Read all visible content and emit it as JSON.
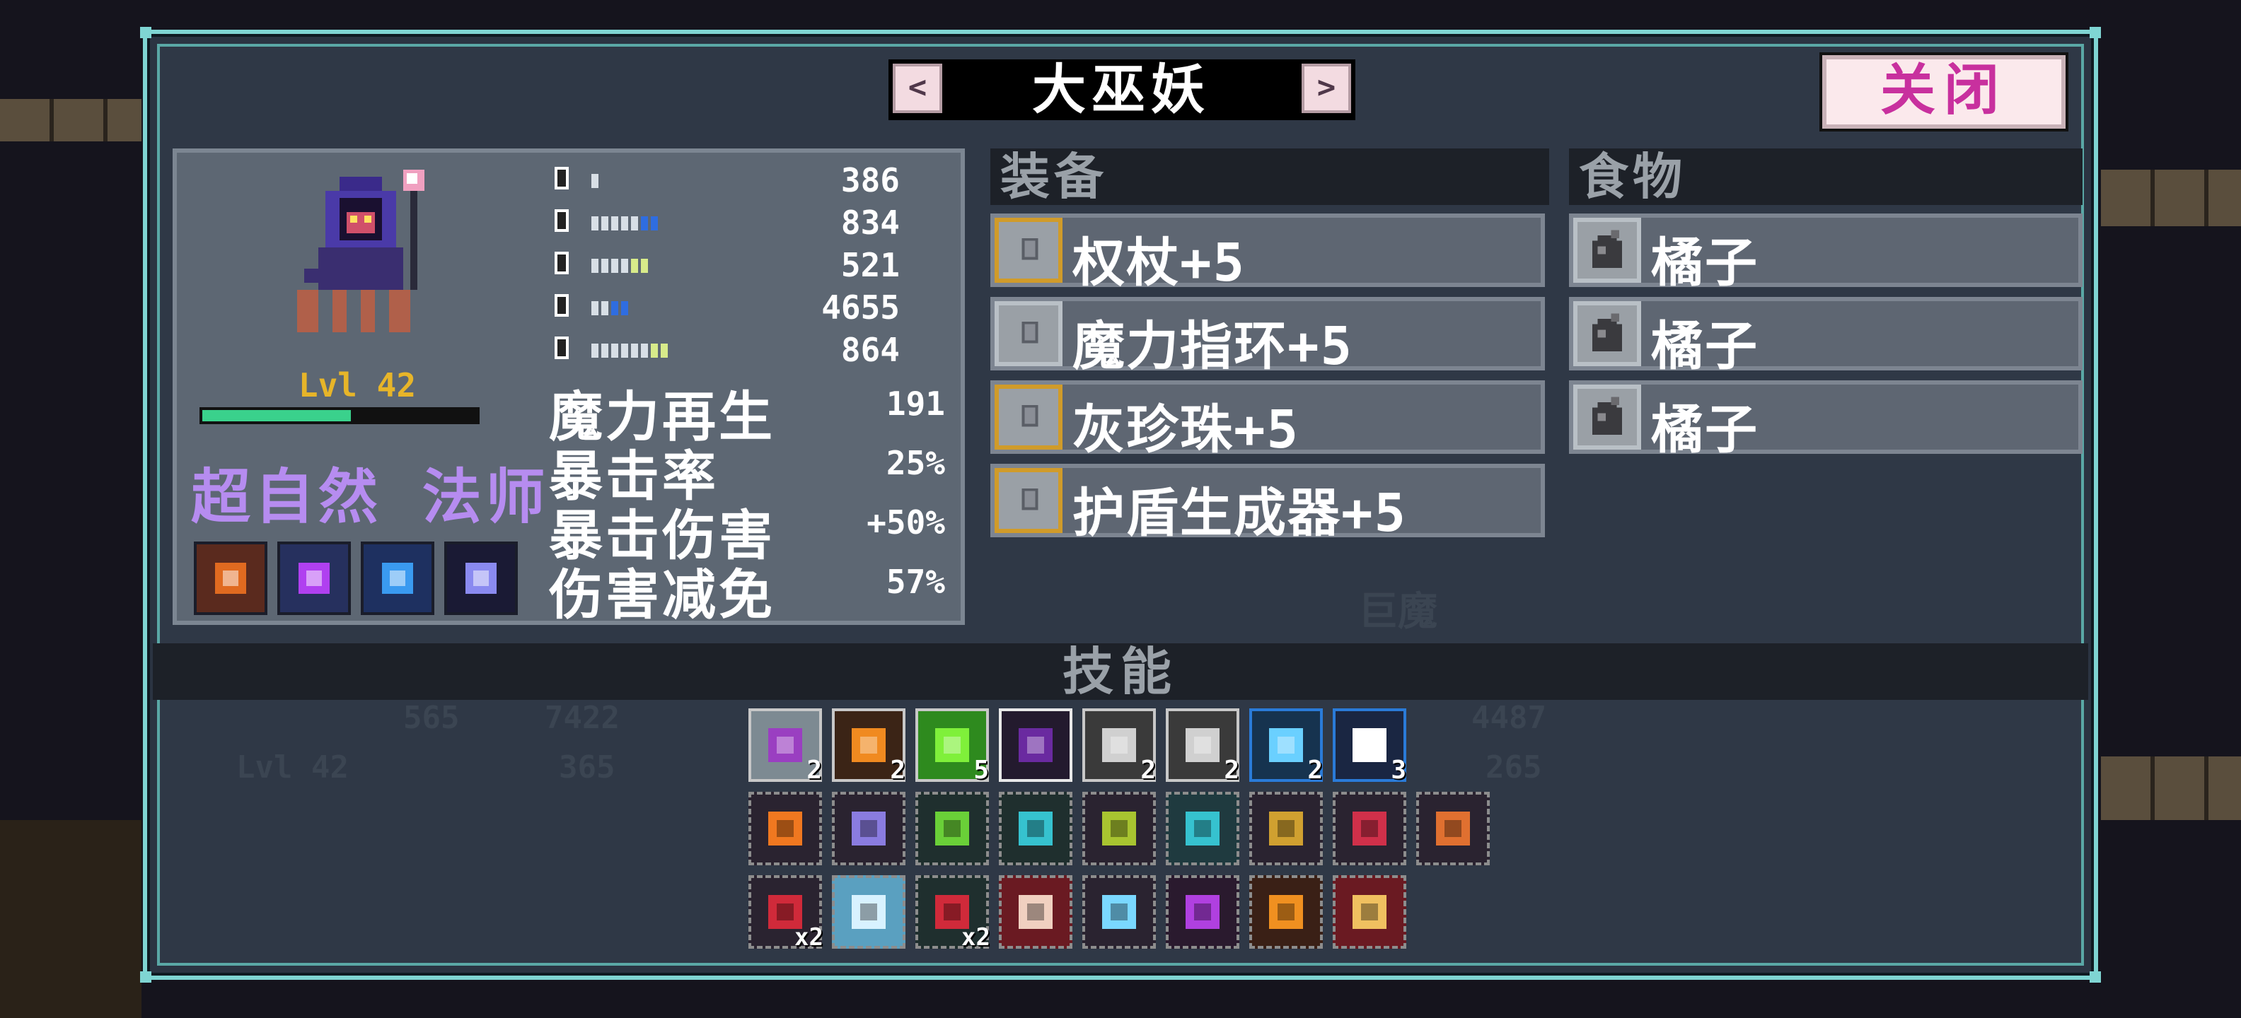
{
  "header": {
    "title": "大巫妖",
    "prev_label": "<",
    "next_label": ">",
    "close_label": "关闭"
  },
  "character": {
    "level": "Lvl 42",
    "xp_fraction": 0.54,
    "class_name": "超自然 法师",
    "traits": [
      "staff-boost-icon",
      "purple-orb-shield-icon",
      "water-drop-shield-icon",
      "crescent-moon-icon"
    ],
    "bar_stats": [
      {
        "icon": "sword-icon",
        "value": "386",
        "pips": 1,
        "accent": 0
      },
      {
        "icon": "wand-icon",
        "value": "834",
        "pips": 7,
        "accent": 1
      },
      {
        "icon": "shield-icon",
        "value": "521",
        "pips": 6,
        "accent": 2
      },
      {
        "icon": "heart-icon",
        "value": "4655",
        "pips": 4,
        "accent": 1
      },
      {
        "icon": "potion-icon",
        "value": "864",
        "pips": 8,
        "accent": 2
      }
    ],
    "stats": [
      {
        "label": "魔力再生",
        "value": "191"
      },
      {
        "label": "暴击率",
        "value": "25%"
      },
      {
        "label": "暴击伤害",
        "value": "+50%"
      },
      {
        "label": "伤害减免",
        "value": "57%"
      }
    ]
  },
  "equipment": {
    "header": "装备",
    "items": [
      {
        "label": "权杖+5",
        "icon": "scepter-icon",
        "gold": true
      },
      {
        "label": "魔力指环+5",
        "icon": "ring-icon",
        "gold": false
      },
      {
        "label": "灰珍珠+5",
        "icon": "pearl-icon",
        "gold": true
      },
      {
        "label": "护盾生成器+5",
        "icon": "shield-generator-icon",
        "gold": true
      }
    ]
  },
  "food": {
    "header": "食物",
    "items": [
      {
        "label": "橘子",
        "icon": "orange-icon"
      },
      {
        "label": "橘子",
        "icon": "orange-icon"
      },
      {
        "label": "橘子",
        "icon": "orange-icon"
      }
    ]
  },
  "skills": {
    "header": "技能",
    "active": [
      {
        "icon": "poison-flask-icon",
        "count": "2",
        "bg": "#7d8a92",
        "fg": "#9a3fc1",
        "border": "#c8c8c8"
      },
      {
        "icon": "fire-target-icon",
        "count": "2",
        "bg": "#3b2416",
        "fg": "#f08a20",
        "border": "#c8c8c8"
      },
      {
        "icon": "green-blast-icon",
        "count": "5",
        "bg": "#2e8a1e",
        "fg": "#7ff03a",
        "border": "#c8c8c8"
      },
      {
        "icon": "dark-orb-icon",
        "count": "",
        "bg": "#231a2e",
        "fg": "#6a2aa0",
        "border": "#e8e8e8"
      },
      {
        "icon": "whirlwind-icon",
        "count": "2",
        "bg": "#3a3a3a",
        "fg": "#d0d0d0",
        "border": "#c8c8c8"
      },
      {
        "icon": "whirlwind-icon",
        "count": "2",
        "bg": "#3a3a3a",
        "fg": "#d0d0d0",
        "border": "#c8c8c8"
      },
      {
        "icon": "ice-comet-icon",
        "count": "2",
        "bg": "#16334f",
        "fg": "#6ad0ff",
        "border": "#2a7bd8"
      },
      {
        "icon": "star-rain-icon",
        "count": "3",
        "bg": "#1a2642",
        "fg": "#ffffff",
        "border": "#2a7bd8"
      }
    ],
    "passives_row1": [
      {
        "icon": "fire-bat-icon",
        "count": "",
        "bg": "#2a2330",
        "fg": "#f07820"
      },
      {
        "icon": "ghost-skull-icon",
        "count": "",
        "bg": "#2a2330",
        "fg": "#8a7ce0"
      },
      {
        "icon": "green-ring-icon",
        "count": "",
        "bg": "#1f2f2e",
        "fg": "#6ad038"
      },
      {
        "icon": "cyan-ring-icon",
        "count": "",
        "bg": "#1f2f2e",
        "fg": "#36c2cf"
      },
      {
        "icon": "clover-icon",
        "count": "",
        "bg": "#2a2330",
        "fg": "#a8c430"
      },
      {
        "icon": "shielded-orb-icon",
        "count": "",
        "bg": "#1f3a3f",
        "fg": "#36c2cf"
      },
      {
        "icon": "speed-boot-icon",
        "count": "",
        "bg": "#2a2330",
        "fg": "#d0a030"
      },
      {
        "icon": "red-dots-icon",
        "count": "",
        "bg": "#2a2330",
        "fg": "#d0304a"
      },
      {
        "icon": "drumstick-icon",
        "count": "",
        "bg": "#2a2330",
        "fg": "#e07030"
      }
    ],
    "passives_row2": [
      {
        "icon": "blood-drop-icon",
        "count": "x2",
        "bg": "#2a2330",
        "fg": "#d02a3a"
      },
      {
        "icon": "icicle-icon",
        "count": "",
        "bg": "#5aa0c0",
        "fg": "#d8f2ff"
      },
      {
        "icon": "fire-skull-icon",
        "count": "x2",
        "bg": "#1f2f2e",
        "fg": "#d02a3a"
      },
      {
        "icon": "cracked-bone-icon",
        "count": "",
        "bg": "#6a1a22",
        "fg": "#f0d0c0"
      },
      {
        "icon": "blue-skull-icon",
        "count": "",
        "bg": "#2a2330",
        "fg": "#7ad8ff"
      },
      {
        "icon": "purple-heart-icon",
        "count": "",
        "bg": "#2a1a2e",
        "fg": "#b040e0"
      },
      {
        "icon": "fire-explosion-icon",
        "count": "",
        "bg": "#3a2016",
        "fg": "#f09020"
      },
      {
        "icon": "bone-plus-icon",
        "count": "",
        "bg": "#6a1a22",
        "fg": "#f0c060"
      }
    ]
  },
  "ghost_text": {
    "a": "巨魔",
    "b": "Lvl 42",
    "c": "565",
    "d": "7422",
    "e": "365",
    "f": "4487",
    "g": "265"
  },
  "colors": {
    "frame": "#7fd5d3",
    "gold_border": "#d09b2a",
    "class_text": "#b68cf0",
    "level_text": "#e7b529",
    "xp_fill": "#3ad18c",
    "close_text": "#c8309e"
  }
}
